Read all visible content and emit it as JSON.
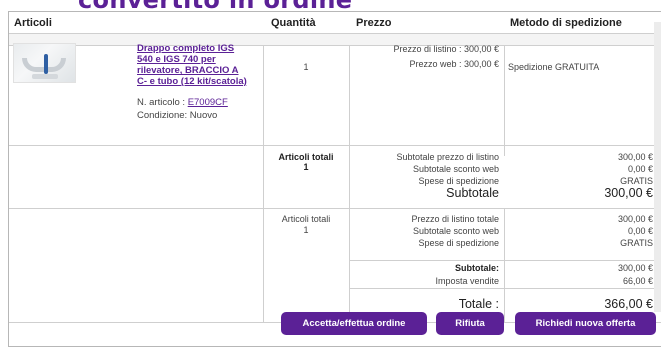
{
  "page": {
    "heading": "convertito in ordine"
  },
  "table": {
    "headers": {
      "articles": "Articoli",
      "quantity": "Quantità",
      "price": "Prezzo",
      "shipping": "Metodo di spedizione"
    }
  },
  "product": {
    "image_icon": "product-photo",
    "name": "Drappo completo IGS 540 e IGS 740 per rilevatore, BRACCIO A C- e tubo (12 kit/scatola)",
    "article_label": "N. articolo : ",
    "article_number": "E7009CF",
    "condition": "Condizione: Nuovo",
    "quantity": "1",
    "list_price": "Prezzo di listino : 300,00 €",
    "web_price": "Prezzo web : 300,00 €",
    "shipping": "Spedizione GRATUITA"
  },
  "subtotal_block": {
    "total_items_label": "Articoli totali",
    "total_items_value": "1",
    "lines": [
      {
        "label": "Subtotale prezzo di listino",
        "value": "300,00 €"
      },
      {
        "label": "Subtotale sconto web",
        "value": "0,00 €"
      },
      {
        "label": "Spese di spedizione",
        "value": "GRATIS"
      }
    ],
    "subtotal_label": "Subtotale",
    "subtotal_value": "300,00 €"
  },
  "summary_block": {
    "total_items_label": "Articoli totali",
    "total_items_value": "1",
    "lines": [
      {
        "label": "Prezzo di listino totale",
        "value": "300,00 €"
      },
      {
        "label": "Subtotale sconto web",
        "value": "0,00 €"
      },
      {
        "label": "Spese di spedizione",
        "value": "GRATIS"
      }
    ],
    "subtotal_label": "Subtotale:",
    "subtotal_value": "300,00 €",
    "tax_label": "Imposta vendite",
    "tax_value": "66,00 €",
    "total_label": "Totale :",
    "total_value": "366,00 €"
  },
  "actions": {
    "accept": "Accetta/effettua ordine",
    "reject": "Rifiuta",
    "new_quote": "Richiedi nuova offerta"
  },
  "colors": {
    "brand": "#5b2196"
  }
}
